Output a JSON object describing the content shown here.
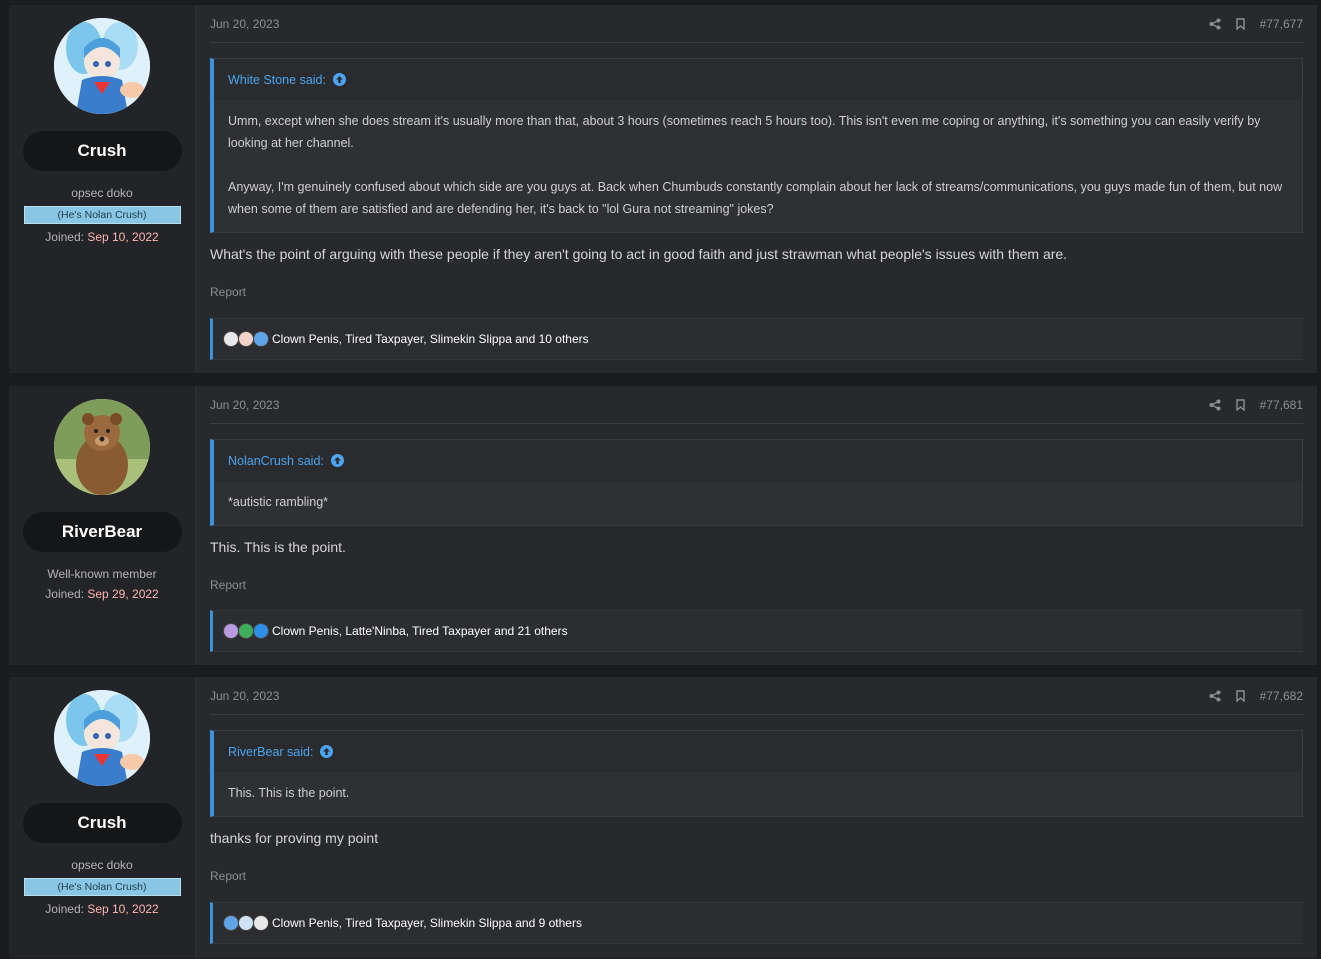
{
  "posts": [
    {
      "username": "Crush",
      "user_title": "opsec doko",
      "banner": "(He's Nolan Crush)",
      "joined_label": "Joined:",
      "joined_date": "Sep 10, 2022",
      "date": "Jun 20, 2023",
      "post_number": "#77,677",
      "quote_author": "White Stone said:",
      "quote_paragraphs": [
        "Umm, except when she does stream it's usually more than that, about 3 hours (sometimes reach 5 hours too). This isn't even me coping or anything, it's something you can easily verify by looking at her channel.",
        "Anyway, I'm genuinely confused about which side are you guys at. Back when Chumbuds constantly complain about her lack of streams/communications, you guys made fun of them, but now when some of them are satisfied and are defending her, it's back to \"lol Gura not streaming\" jokes?"
      ],
      "message": "What's the point of arguing with these people if they aren't going to act in good faith and just strawman what people's issues with them are.",
      "report": "Report",
      "reactions": "Clown Penis, Tired Taxpayer, Slimekin Slippa and 10 others",
      "avatar_icon": "anime-avatar"
    },
    {
      "username": "RiverBear",
      "user_title": "Well-known member",
      "banner": "",
      "joined_label": "Joined:",
      "joined_date": "Sep 29, 2022",
      "date": "Jun 20, 2023",
      "post_number": "#77,681",
      "quote_author": "NolanCrush said:",
      "quote_paragraphs": [
        "*autistic rambling*"
      ],
      "message": "This. This is the point.",
      "report": "Report",
      "reactions": "Clown Penis, Latte'Ninba, Tired Taxpayer and 21 others",
      "avatar_icon": "bear-avatar"
    },
    {
      "username": "Crush",
      "user_title": "opsec doko",
      "banner": "(He's Nolan Crush)",
      "joined_label": "Joined:",
      "joined_date": "Sep 10, 2022",
      "date": "Jun 20, 2023",
      "post_number": "#77,682",
      "quote_author": "RiverBear said:",
      "quote_paragraphs": [
        "This. This is the point."
      ],
      "message": "thanks for proving my point",
      "report": "Report",
      "reactions": "Clown Penis, Tired Taxpayer, Slimekin Slippa and 9 others",
      "avatar_icon": "anime-avatar"
    }
  ],
  "colors": {
    "accent": "#3b92d8",
    "link": "#4aa4ef",
    "joined_date": "#ffb4b4",
    "banner": "#89c6e3"
  }
}
